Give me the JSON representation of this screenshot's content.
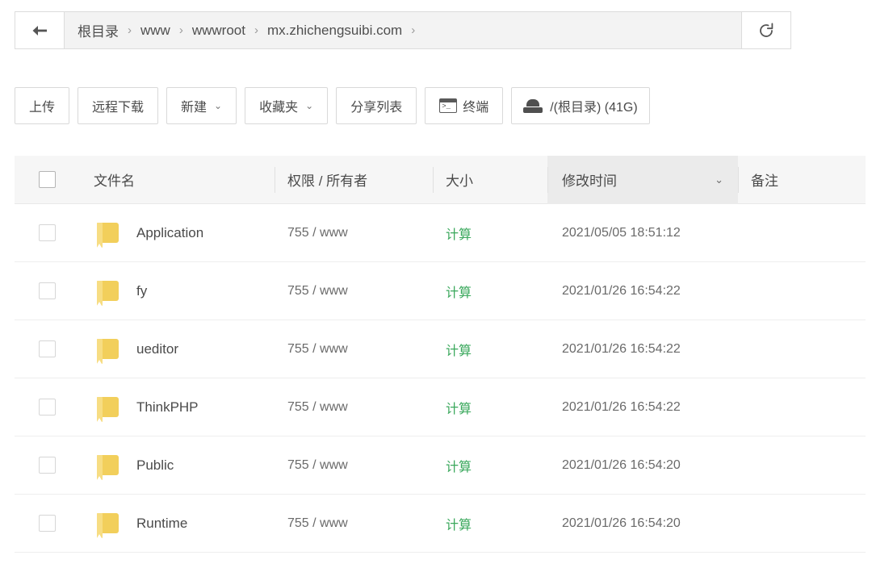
{
  "breadcrumb": {
    "back_icon": "arrow-left-icon",
    "refresh_icon": "refresh-icon",
    "separator": "›",
    "items": [
      "根目录",
      "www",
      "wwwroot",
      "mx.zhichengsuibi.com"
    ],
    "trailing_separator": "›"
  },
  "toolbar": {
    "upload": "上传",
    "remote_download": "远程下载",
    "new": "新建",
    "favorites": "收藏夹",
    "share_list": "分享列表",
    "terminal": "终端",
    "disk": "/(根目录) (41G)",
    "caret": "⌄"
  },
  "table": {
    "columns": {
      "name": "文件名",
      "permission": "权限 / 所有者",
      "size": "大小",
      "modified": "修改时间",
      "note": "备注"
    },
    "sort_caret": "⌄",
    "sorted_column": "修改时间",
    "rows": [
      {
        "name": "Application",
        "permission": "755 / www",
        "size": "计算",
        "modified": "2021/05/05 18:51:12",
        "note": ""
      },
      {
        "name": "fy",
        "permission": "755 / www",
        "size": "计算",
        "modified": "2021/01/26 16:54:22",
        "note": ""
      },
      {
        "name": "ueditor",
        "permission": "755 / www",
        "size": "计算",
        "modified": "2021/01/26 16:54:22",
        "note": ""
      },
      {
        "name": "ThinkPHP",
        "permission": "755 / www",
        "size": "计算",
        "modified": "2021/01/26 16:54:22",
        "note": ""
      },
      {
        "name": "Public",
        "permission": "755 / www",
        "size": "计算",
        "modified": "2021/01/26 16:54:20",
        "note": ""
      },
      {
        "name": "Runtime",
        "permission": "755 / www",
        "size": "计算",
        "modified": "2021/01/26 16:54:20",
        "note": ""
      }
    ]
  },
  "colors": {
    "folder": "#f2cf5b",
    "calc_link": "#3aa85c",
    "header_bg": "#f6f6f6",
    "sorted_col_bg": "#ebebeb"
  }
}
